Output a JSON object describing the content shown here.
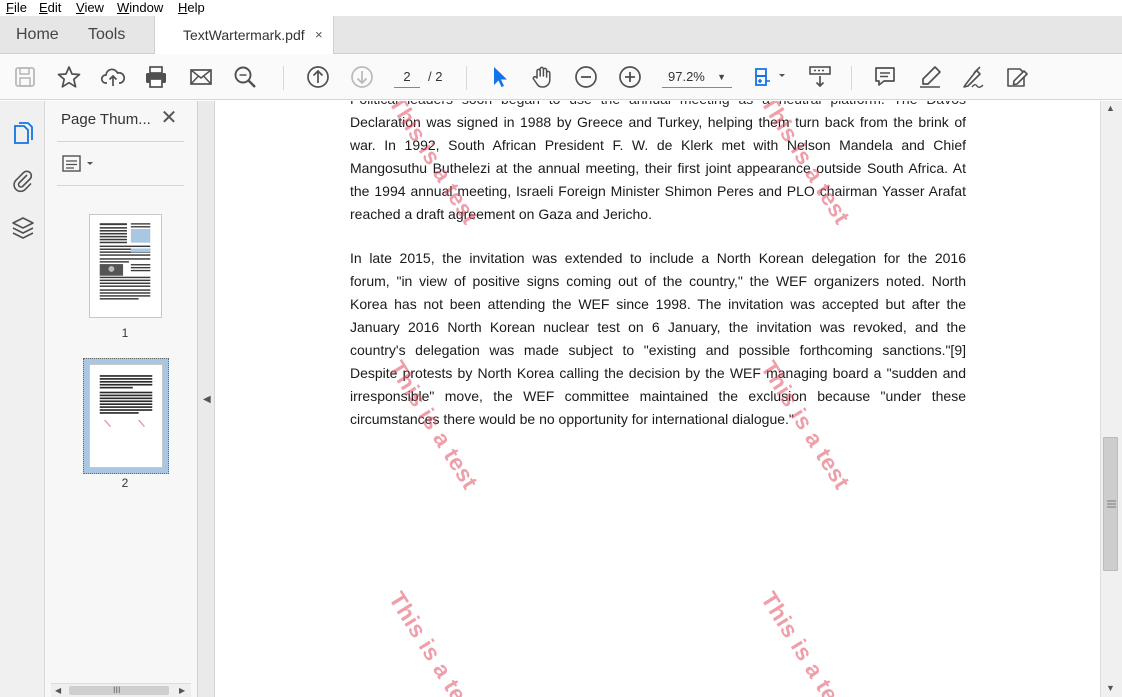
{
  "menu": {
    "file": {
      "accel": "F",
      "rest": "ile"
    },
    "edit": {
      "accel": "E",
      "rest": "dit"
    },
    "view": {
      "accel": "V",
      "rest": "iew"
    },
    "window": {
      "accel": "W",
      "rest": "indow"
    },
    "help": {
      "accel": "H",
      "rest": "elp"
    }
  },
  "tabs": {
    "home": "Home",
    "tools": "Tools",
    "document": "TextWartermark.pdf",
    "close_glyph": "×"
  },
  "toolbar": {
    "icons": [
      "save-icon",
      "bookmark-star-icon",
      "upload-cloud-icon",
      "print-icon",
      "email-icon",
      "find-zoom-icon",
      "previous-page-icon",
      "next-page-icon",
      "select-cursor-icon",
      "hand-tool-icon",
      "zoom-out-icon",
      "zoom-in-icon",
      "fit-page-icon",
      "scroll-mode-icon",
      "comment-icon",
      "highlight-pen-icon",
      "sign-pen-icon",
      "edit-pdf-icon"
    ],
    "current_page": "2",
    "page_total": "/ 2",
    "zoom": "97.2%",
    "accent_color": "#1473e6"
  },
  "sidebar": {
    "panel_title": "Page Thum...",
    "close_glyph": "✕",
    "thumbnails": [
      {
        "label": "1"
      },
      {
        "label": "2"
      }
    ],
    "hscroll_grip": "III"
  },
  "document": {
    "paragraph1": {
      "cut_line": "Political leaders soon began to use the annual meeting as a neutral platform. The Davos",
      "lines": [
        "Declaration was signed in 1988 by Greece and Turkey, helping them turn back from the brink of",
        "war. In 1992, South African President F. W. de Klerk met with Nelson Mandela and Chief",
        "Mangosuthu Buthelezi at the annual meeting, their first joint appearance outside South Africa. At",
        "the 1994 annual meeting, Israeli Foreign Minister Shimon Peres and PLO chairman Yasser Arafat",
        "reached a draft agreement on Gaza and Jericho."
      ]
    },
    "paragraph2": {
      "lines": [
        "In late 2015, the invitation was extended to include a North Korean delegation for the 2016",
        "forum, \"in view of positive signs coming out of the country,\" the WEF organizers noted. North",
        "Korea has not been attending the WEF since 1998. The invitation was accepted but after the",
        "January 2016 North Korean nuclear test on 6 January, the invitation was revoked, and the",
        "country's delegation was made subject to \"existing and possible forthcoming sanctions.\"[9]",
        "Despite protests by North Korea calling the decision by the WEF managing board a \"sudden and",
        "irresponsible\" move, the WEF committee maintained the exclusion because \"under these",
        "circumstances there would be no opportunity for international dialogue.\""
      ]
    },
    "watermark_text": "This is a test",
    "watermark_color": "#e05064"
  },
  "scrollbar": {
    "up_glyph": "▲",
    "down_glyph": "▼"
  }
}
